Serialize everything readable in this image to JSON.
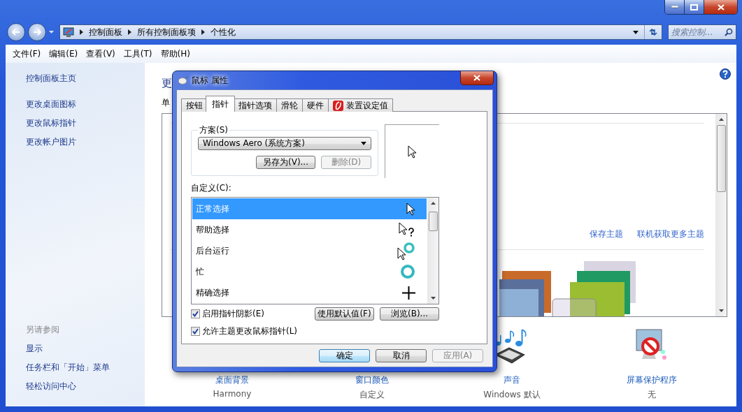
{
  "window": {
    "address_path": [
      "控制面板",
      "所有控制面板项",
      "个性化"
    ],
    "search": {
      "placeholder": "搜索控制..."
    }
  },
  "menu_bar": [
    "文件(F)",
    "编辑(E)",
    "查看(V)",
    "工具(T)",
    "帮助(H)"
  ],
  "sidebar": {
    "links": [
      "控制面板主页",
      "更改桌面图标",
      "更改鼠标指针",
      "更改帐户图片"
    ],
    "see_also_title": "另请参阅",
    "see_also": [
      "显示",
      "任务栏和「开始」菜单",
      "轻松访问中心"
    ]
  },
  "main": {
    "heading": "更",
    "subheading": "单",
    "theme_links": [
      "保存主题",
      "联机获取更多主题"
    ],
    "themes": [
      {
        "selected": false
      },
      {
        "selected": true
      }
    ],
    "settings": [
      {
        "kind": "wallpaper",
        "label": "桌面背景",
        "value": "Harmony"
      },
      {
        "kind": "color",
        "label": "窗口颜色",
        "value": "自定义"
      },
      {
        "kind": "sound",
        "label": "声音",
        "value": "Windows 默认"
      },
      {
        "kind": "screensaver",
        "label": "屏幕保护程序",
        "value": "无"
      }
    ]
  },
  "dialog": {
    "title": "鼠标 属性",
    "tabs": [
      {
        "label": "按钮",
        "selected": false,
        "kind": "text"
      },
      {
        "label": "指针",
        "selected": true,
        "kind": "text"
      },
      {
        "label": "指针选项",
        "selected": false,
        "kind": "text"
      },
      {
        "label": "滑轮",
        "selected": false,
        "kind": "text"
      },
      {
        "label": "硬件",
        "selected": false,
        "kind": "text"
      },
      {
        "label": "装置设定值",
        "selected": false,
        "kind": "device"
      }
    ],
    "scheme": {
      "label": "方案(S)",
      "value": "Windows Aero (系统方案)",
      "buttons": [
        {
          "label": "另存为(V)...",
          "disabled": false
        },
        {
          "label": "删除(D)",
          "disabled": true
        }
      ]
    },
    "customize_label": "自定义(C):",
    "cursors": [
      {
        "name": "正常选择",
        "kind": "arrow",
        "selected": true
      },
      {
        "name": "帮助选择",
        "kind": "help",
        "selected": false
      },
      {
        "name": "后台运行",
        "kind": "working",
        "selected": false
      },
      {
        "name": "忙",
        "kind": "busy",
        "selected": false
      },
      {
        "name": "精确选择",
        "kind": "precision",
        "selected": false
      }
    ],
    "options": [
      {
        "label": "启用指针阴影(E)",
        "checked": true
      },
      {
        "label": "允许主题更改鼠标指针(L)",
        "checked": true
      }
    ],
    "list_buttons": [
      "使用默认值(F)",
      "浏览(B)..."
    ],
    "buttons": [
      {
        "label": "确定",
        "default": true,
        "disabled": false
      },
      {
        "label": "取消",
        "default": false,
        "disabled": false
      },
      {
        "label": "应用(A)",
        "default": false,
        "disabled": true
      }
    ]
  }
}
